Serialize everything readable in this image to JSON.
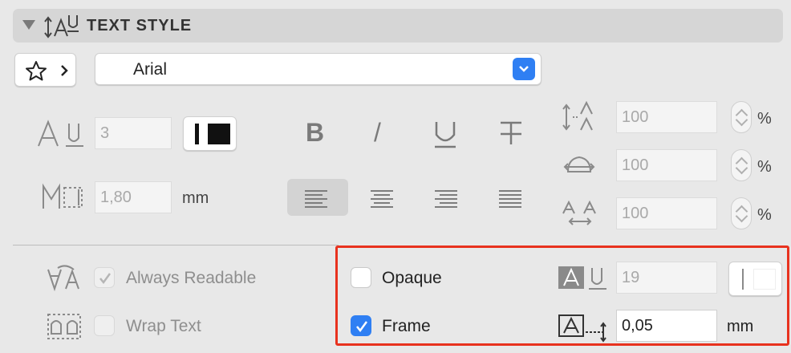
{
  "header": {
    "title": "TEXT STYLE"
  },
  "font": {
    "name": "Arial"
  },
  "size": {
    "pen_value": "3",
    "height_value": "1,80",
    "height_unit": "mm"
  },
  "percent_fields": [
    {
      "value": "100",
      "unit": "%"
    },
    {
      "value": "100",
      "unit": "%"
    },
    {
      "value": "100",
      "unit": "%"
    }
  ],
  "formatting": {
    "italic_glyph": "/",
    "bold_glyph": "B"
  },
  "options": {
    "always_readable": {
      "label": "Always Readable",
      "checked": true
    },
    "wrap_text": {
      "label": "Wrap Text",
      "checked": false
    },
    "opaque": {
      "label": "Opaque",
      "checked": false
    },
    "frame": {
      "label": "Frame",
      "checked": true
    }
  },
  "background_pen": {
    "value": "19"
  },
  "frame_offset": {
    "value": "0,05",
    "unit": "mm"
  },
  "colors": {
    "accent": "#2f7ff3",
    "highlight": "#e8321e"
  }
}
